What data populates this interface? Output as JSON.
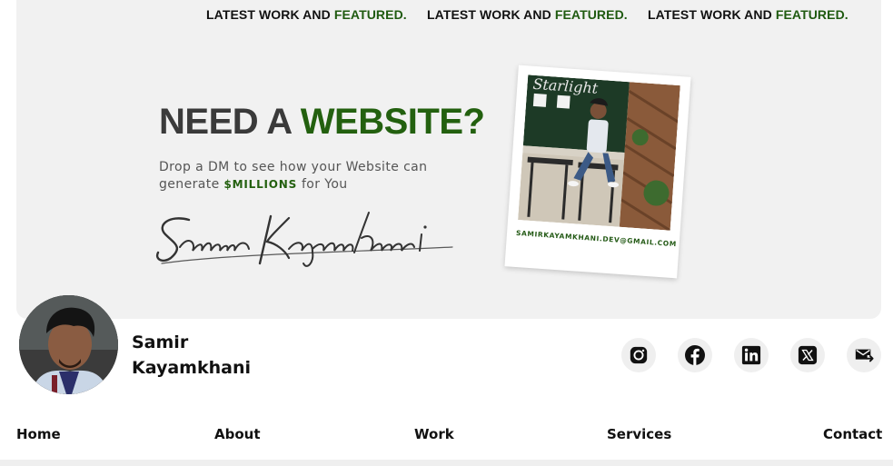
{
  "marquee": {
    "items": [
      {
        "prefix": "LATEST WORK AND ",
        "highlight": "FEATURED."
      },
      {
        "prefix": "LATEST WORK AND ",
        "highlight": "FEATURED."
      },
      {
        "prefix": "LATEST WORK AND ",
        "highlight": "FEATURED."
      }
    ]
  },
  "banner": {
    "headline_part1": "NEED A ",
    "headline_part2": "WEBSITE?",
    "sub_line1": "Drop a DM to see how your Website can",
    "sub_line2_before": "generate ",
    "sub_line2_money": "$MILLIONS",
    "sub_line2_after": " for You",
    "signature": "Samir Kayamkhani",
    "photo_sign": "Starlight",
    "email": "SAMIRKAYAMKHANI.DEV@GMAIL.COM"
  },
  "profile": {
    "first_name": "Samir",
    "last_name": "Kayamkhani"
  },
  "socials": [
    {
      "icon": "instagram-icon"
    },
    {
      "icon": "facebook-icon"
    },
    {
      "icon": "linkedin-icon"
    },
    {
      "icon": "x-twitter-icon"
    },
    {
      "icon": "mail-send-icon"
    }
  ],
  "nav": {
    "home": "Home",
    "about": "About",
    "work": "Work",
    "services": "Services",
    "contact": "Contact"
  },
  "colors": {
    "accent": "#23600f",
    "banner_bg": "#f1f1f1",
    "text": "#111111"
  }
}
